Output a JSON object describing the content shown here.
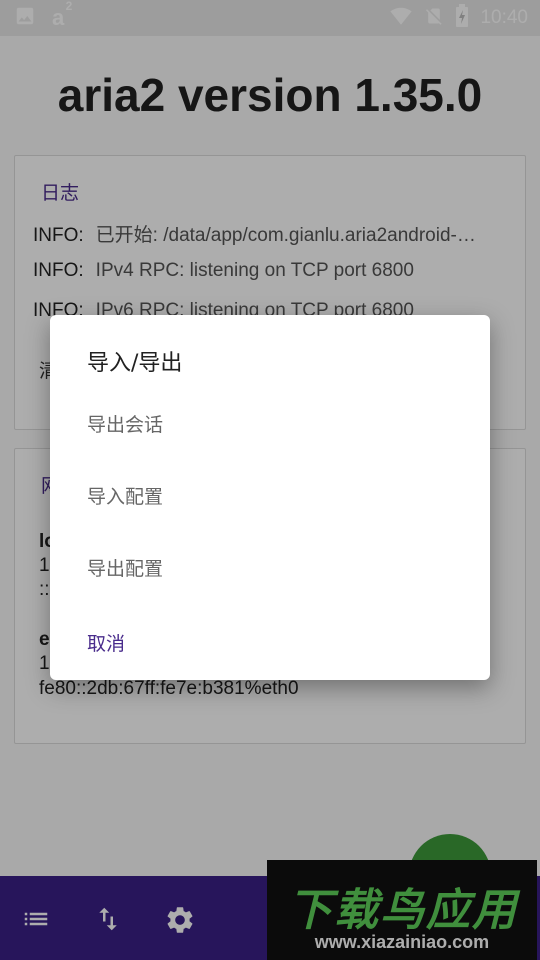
{
  "status_bar": {
    "time": "10:40",
    "left_icons": [
      "image-icon",
      "a-superscript-icon"
    ],
    "a_label": "a",
    "a_sup": "2",
    "right_icons": [
      "wifi-icon",
      "no-sim-icon",
      "battery-charging-icon"
    ]
  },
  "app": {
    "title": "aria2 version 1.35.0"
  },
  "log_card": {
    "header": "日志",
    "lines": [
      {
        "tag": "INFO:",
        "msg": "已开始: /data/app/com.gianlu.aria2android-…"
      },
      {
        "tag": "INFO:",
        "msg": "IPv4 RPC: listening on TCP port 6800"
      },
      {
        "tag": "INFO:",
        "msg": "IPv6 RPC: listening on TCP port 6800"
      }
    ],
    "clear_label": "清"
  },
  "network_card": {
    "header": "网",
    "lo_label": "lo",
    "lo_line1": "1",
    "lo_line2": "::",
    "eth_label": "e",
    "eth_line1": "1",
    "eth_line2": "fe80::2db:67ff:fe7e:b381%eth0"
  },
  "dialog": {
    "title": "导入/导出",
    "items": [
      "导出会话",
      "导入配置",
      "导出配置"
    ],
    "cancel": "取消"
  },
  "bottom_bar": {
    "icons": [
      "list-icon",
      "swap-vert-icon",
      "settings-icon"
    ]
  },
  "watermark": {
    "text": "下载鸟应用",
    "url": "www.xiazainiao.com"
  },
  "colors": {
    "accent": "#4a2c8c",
    "bottom_bar": "#3a1f86",
    "fab": "#3d9a3a",
    "watermark_green": "#5fd35a"
  }
}
